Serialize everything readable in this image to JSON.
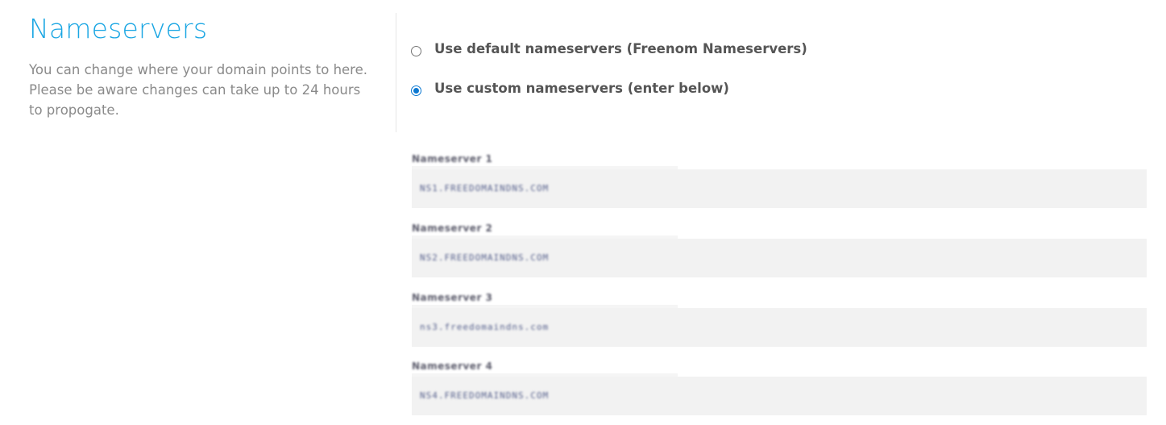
{
  "section": {
    "title": "Nameservers",
    "description": "You can change where your domain points to here. Please be aware changes can take up to 24 hours to propogate."
  },
  "options": {
    "default_label": "Use default nameservers (Freenom Nameservers)",
    "custom_label": "Use custom nameservers (enter below)",
    "selected": "custom"
  },
  "nameservers": [
    {
      "label": "Nameserver 1",
      "value": "NS1.FREEDOMAINDNS.COM"
    },
    {
      "label": "Nameserver 2",
      "value": "NS2.FREEDOMAINDNS.COM"
    },
    {
      "label": "Nameserver 3",
      "value": "ns3.freedomaindns.com"
    },
    {
      "label": "Nameserver 4",
      "value": "NS4.FREEDOMAINDNS.COM"
    }
  ],
  "colors": {
    "title": "#1aa6e3",
    "radio_checked": "#0b78d1",
    "input_bg": "#f2f2f2"
  }
}
